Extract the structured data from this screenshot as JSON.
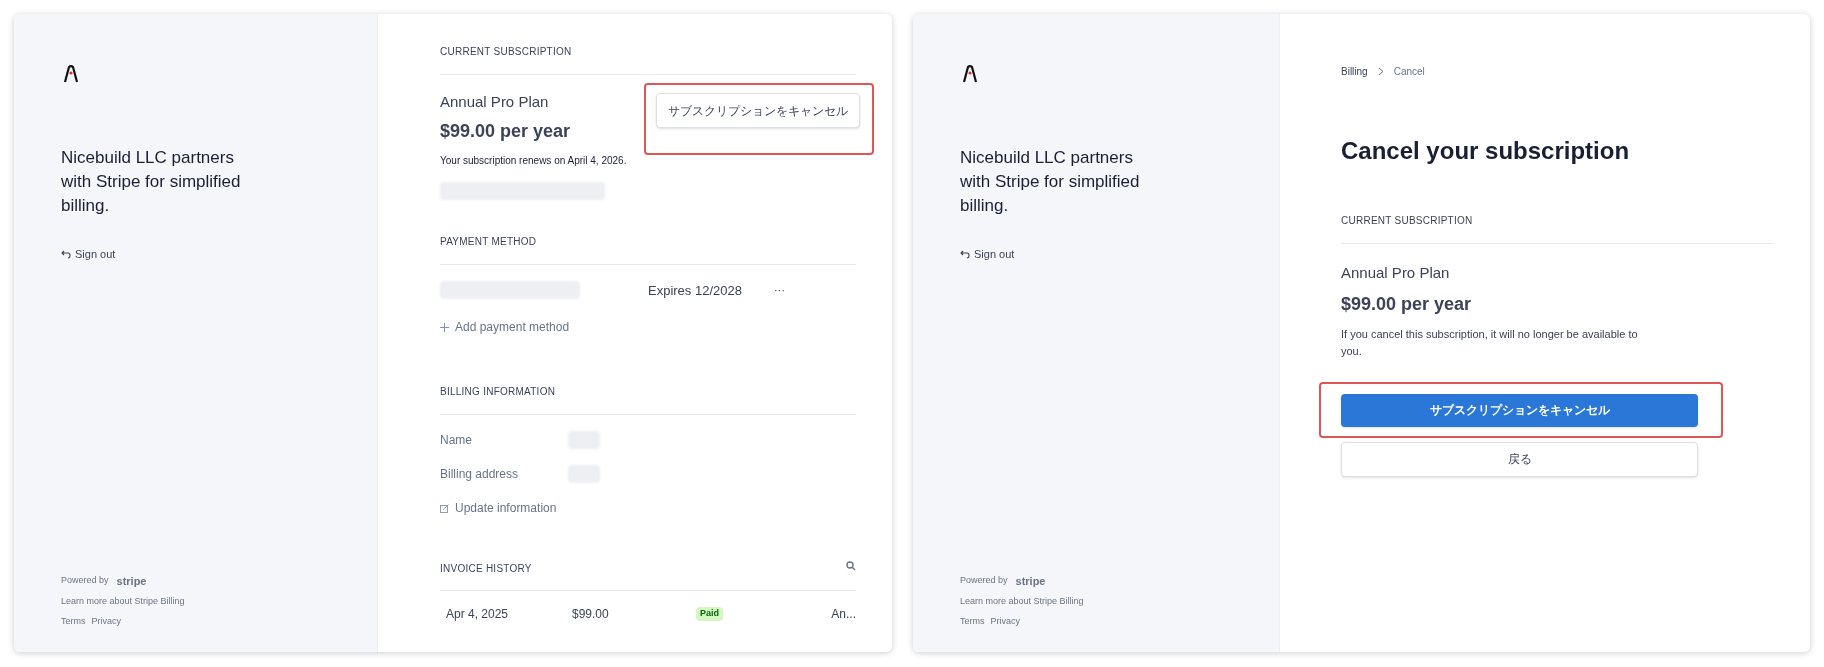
{
  "overview": {
    "sidebar": {
      "tagline": "Nicebuild LLC partners with Stripe for simplified billing.",
      "sign_out": "Sign out",
      "powered_by": "Powered by",
      "brand": "stripe",
      "learn_more": "Learn more about Stripe Billing",
      "links": [
        "Terms",
        "Privacy"
      ]
    },
    "current_subscription": {
      "heading": "CURRENT SUBSCRIPTION",
      "plan": "Annual Pro Plan",
      "price": "$99.00 per year",
      "renews": "Your subscription renews on April 4, 2026.",
      "cancel_button": {
        "label": "サブスクリプションをキャンセル",
        "highlighted": true
      }
    },
    "payment_method": {
      "heading": "PAYMENT METHOD",
      "expires": "Expires 12/2028",
      "more": "···",
      "add": "Add payment method"
    },
    "billing_information": {
      "heading": "BILLING INFORMATION",
      "fields": [
        {
          "label": "Name"
        },
        {
          "label": "Billing address"
        }
      ],
      "update": "Update information"
    },
    "invoice_history": {
      "heading": "INVOICE HISTORY",
      "rows": [
        {
          "date": "Apr 4, 2025",
          "amount": "$99.00",
          "status": "Paid",
          "description": "An..."
        }
      ]
    }
  },
  "cancel_page": {
    "sidebar": {
      "tagline": "Nicebuild LLC partners with Stripe for simplified billing.",
      "sign_out": "Sign out",
      "powered_by": "Powered by",
      "brand": "stripe",
      "learn_more": "Learn more about Stripe Billing",
      "links": [
        "Terms",
        "Privacy"
      ]
    },
    "breadcrumb": [
      "Billing",
      "Cancel"
    ],
    "title": "Cancel your subscription",
    "section_heading": "CURRENT SUBSCRIPTION",
    "plan": "Annual Pro Plan",
    "price": "$99.00 per year",
    "note": "If you cancel this subscription, it will no longer be available to you.",
    "confirm_button": {
      "label": "サブスクリプションをキャンセル",
      "highlighted": true
    },
    "back_button": "戻る"
  }
}
